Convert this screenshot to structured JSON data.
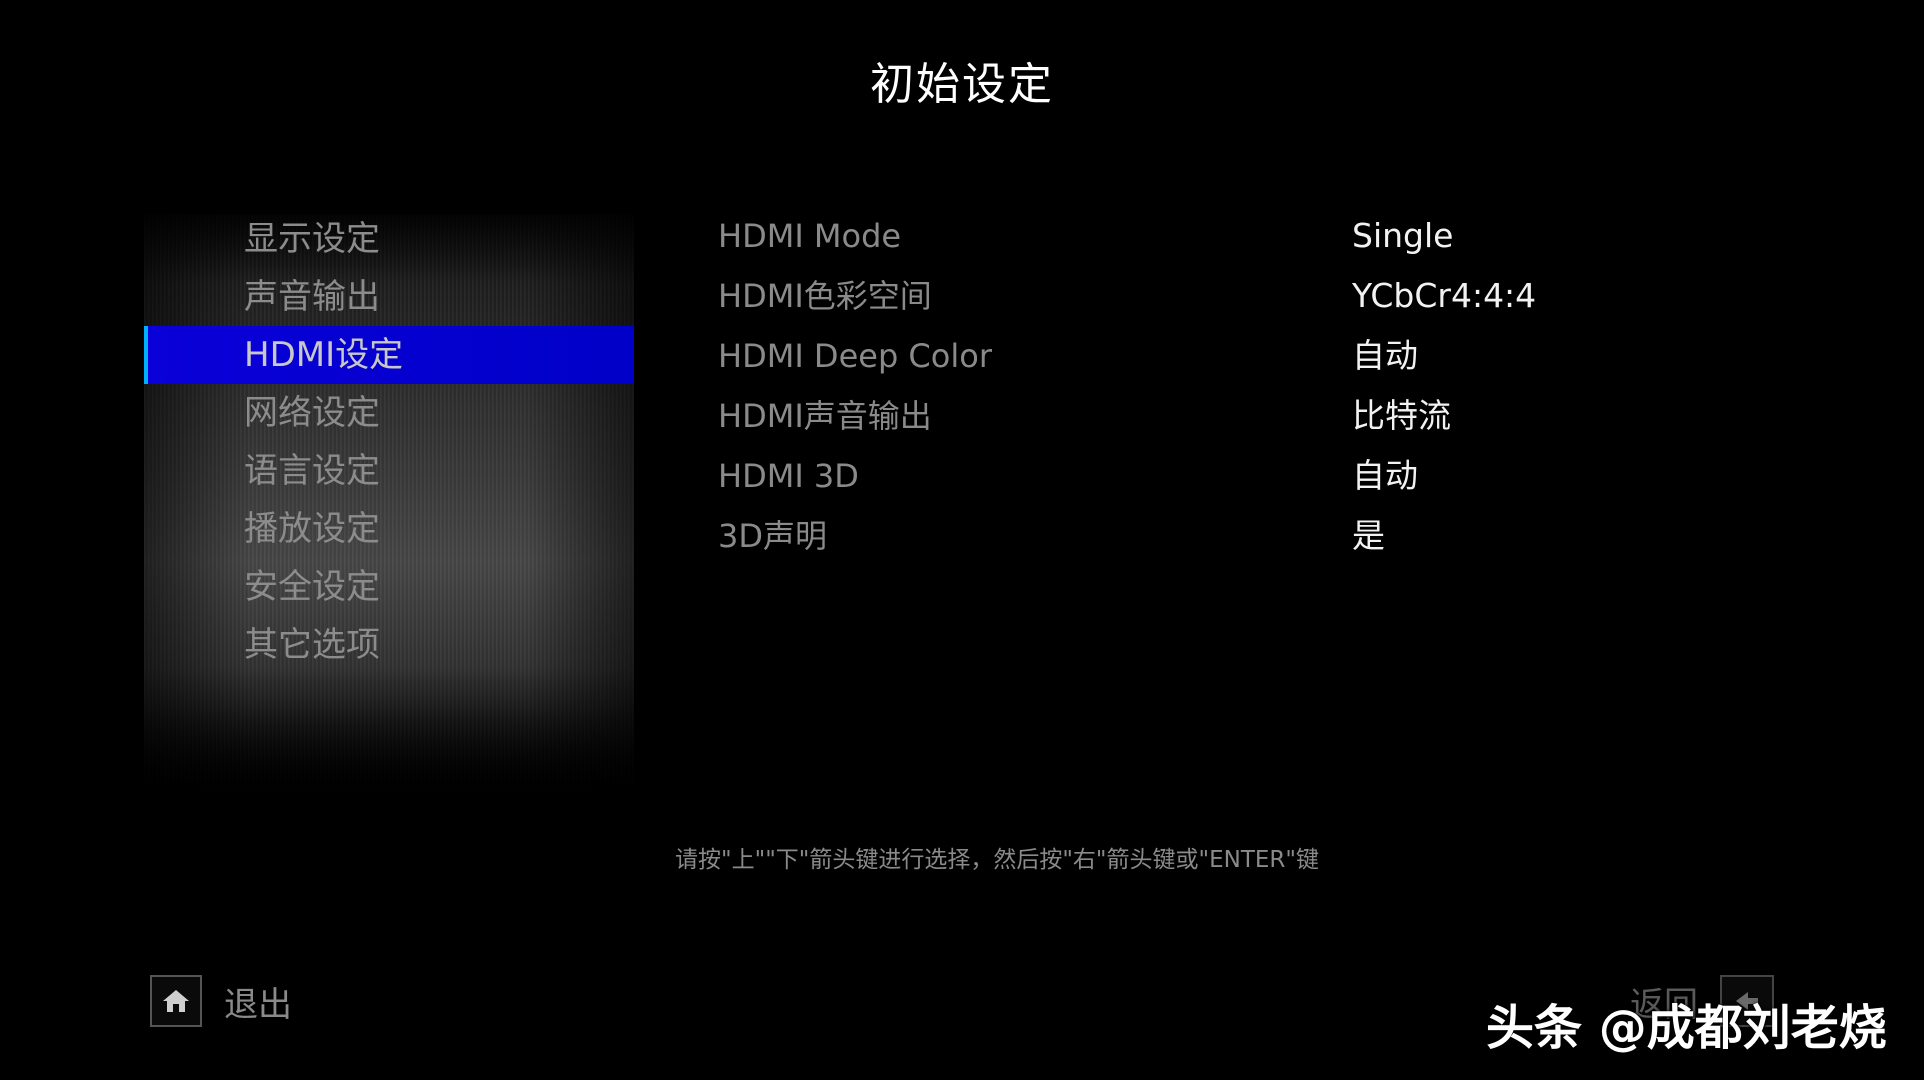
{
  "header": {
    "title": "初始设定"
  },
  "menu": {
    "items": [
      {
        "label": "显示设定",
        "selected": false
      },
      {
        "label": "声音输出",
        "selected": false
      },
      {
        "label": "HDMI设定",
        "selected": true
      },
      {
        "label": "网络设定",
        "selected": false
      },
      {
        "label": "语言设定",
        "selected": false
      },
      {
        "label": "播放设定",
        "selected": false
      },
      {
        "label": "安全设定",
        "selected": false
      },
      {
        "label": "其它选项",
        "selected": false
      }
    ]
  },
  "settings": {
    "rows": [
      {
        "label": "HDMI Mode",
        "value": "Single"
      },
      {
        "label": "HDMI色彩空间",
        "value": "YCbCr4:4:4"
      },
      {
        "label": "HDMI Deep Color",
        "value": "自动"
      },
      {
        "label": "HDMI声音输出",
        "value": "比特流"
      },
      {
        "label": "HDMI 3D",
        "value": "自动"
      },
      {
        "label": "3D声明",
        "value": "是"
      }
    ]
  },
  "hint": {
    "text": "请按\"上\"\"下\"箭头键进行选择，然后按\"右\"箭头键或\"ENTER\"键"
  },
  "footer": {
    "exit_label": "退出",
    "exit_icon": "home-icon",
    "back_label": "返回",
    "back_icon": "back-arrow-icon"
  },
  "watermark": {
    "text": "头条 @成都刘老烧"
  },
  "colors": {
    "background": "#000000",
    "selection": "#0000c8",
    "selection_edge": "#00b0ff",
    "label": "#8a8a8a",
    "value": "#f2f2f2"
  }
}
